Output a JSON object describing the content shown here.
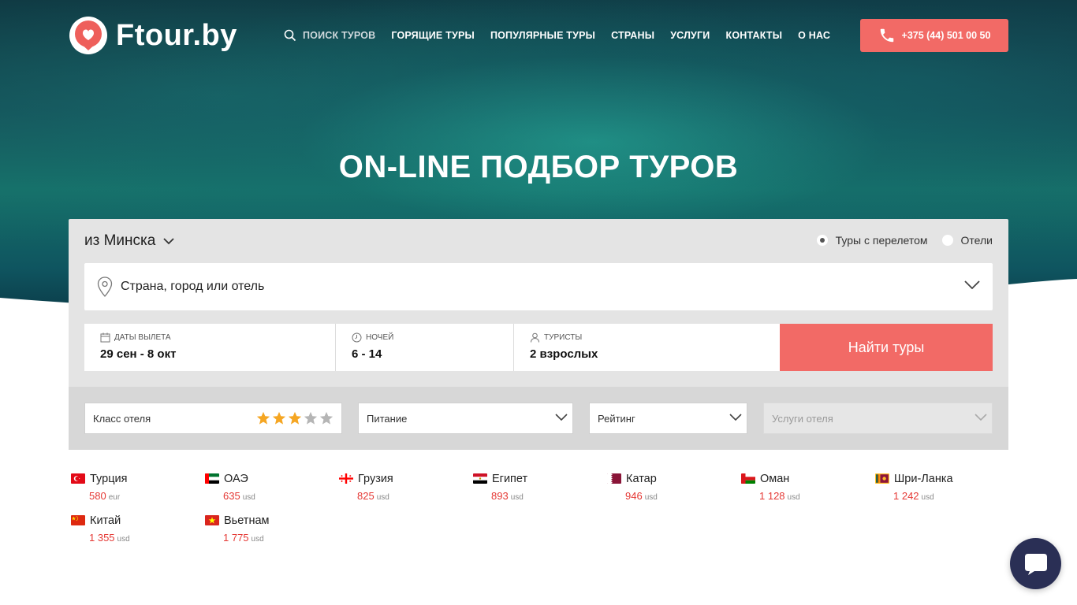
{
  "header": {
    "logo_text": "Ftour.by",
    "nav": [
      {
        "label": "ПОИСК ТУРОВ",
        "icon": "search-icon"
      },
      {
        "label": "ГОРЯЩИЕ ТУРЫ"
      },
      {
        "label": "ПОПУЛЯРНЫЕ ТУРЫ"
      },
      {
        "label": "СТРАНЫ"
      },
      {
        "label": "УСЛУГИ"
      },
      {
        "label": "КОНТАКТЫ"
      },
      {
        "label": "О НАС"
      }
    ],
    "phone": "+375 (44) 501 00 50",
    "accent_color": "#f26a66"
  },
  "hero": {
    "title": "ON-LINE ПОДБОР ТУРОВ"
  },
  "search": {
    "from_city": "из Минска",
    "modes": [
      {
        "label": "Туры с перелетом",
        "selected": true
      },
      {
        "label": "Отели",
        "selected": false
      }
    ],
    "destination_placeholder": "Страна, город или отель",
    "dates_label": "ДАТЫ ВЫЛЕТА",
    "dates_value": "29 сен - 8 окт",
    "nights_label": "НОЧЕЙ",
    "nights_value": "6 - 14",
    "tourists_label": "ТУРИСТЫ",
    "tourists_value": "2 взрослых",
    "find_button": "Найти туры"
  },
  "filters": {
    "hotel_class_label": "Класс отеля",
    "hotel_class_stars": 3,
    "hotel_class_max": 5,
    "food_label": "Питание",
    "rating_label": "Рейтинг",
    "services_label": "Услуги отеля"
  },
  "countries": [
    {
      "name": "Турция",
      "price": "580",
      "currency": "eur",
      "flag": "flag-turkey-icon"
    },
    {
      "name": "ОАЭ",
      "price": "635",
      "currency": "usd",
      "flag": "flag-uae-icon"
    },
    {
      "name": "Грузия",
      "price": "825",
      "currency": "usd",
      "flag": "flag-georgia-icon"
    },
    {
      "name": "Египет",
      "price": "893",
      "currency": "usd",
      "flag": "flag-egypt-icon"
    },
    {
      "name": "Катар",
      "price": "946",
      "currency": "usd",
      "flag": "flag-qatar-icon"
    },
    {
      "name": "Оман",
      "price": "1 128",
      "currency": "usd",
      "flag": "flag-oman-icon"
    },
    {
      "name": "Шри-Ланка",
      "price": "1 242",
      "currency": "usd",
      "flag": "flag-sri-lanka-icon"
    },
    {
      "name": "Китай",
      "price": "1 355",
      "currency": "usd",
      "flag": "flag-china-icon"
    },
    {
      "name": "Вьетнам",
      "price": "1 775",
      "currency": "usd",
      "flag": "flag-vietnam-icon"
    }
  ]
}
